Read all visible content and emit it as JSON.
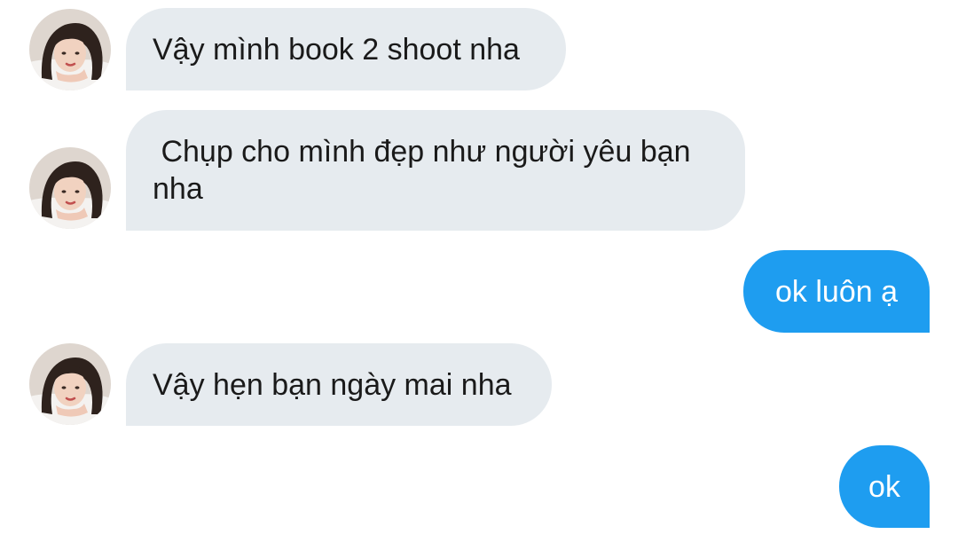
{
  "conversation": {
    "messages": [
      {
        "sender": "contact",
        "text": "Vậy mình book 2 shoot nha"
      },
      {
        "sender": "contact",
        "text": " Chụp cho mình đẹp như người yêu bạn\nnha"
      },
      {
        "sender": "self",
        "text": "ok luôn ạ"
      },
      {
        "sender": "contact",
        "text": "Vậy hẹn bạn ngày mai nha"
      },
      {
        "sender": "self",
        "text": "ok"
      }
    ]
  },
  "colors": {
    "incoming_bubble": "#e6ebef",
    "outgoing_bubble": "#1e9df0",
    "incoming_text": "#1a1a1a",
    "outgoing_text": "#ffffff"
  },
  "icons": {
    "contact_avatar": "contact-avatar-photo"
  }
}
